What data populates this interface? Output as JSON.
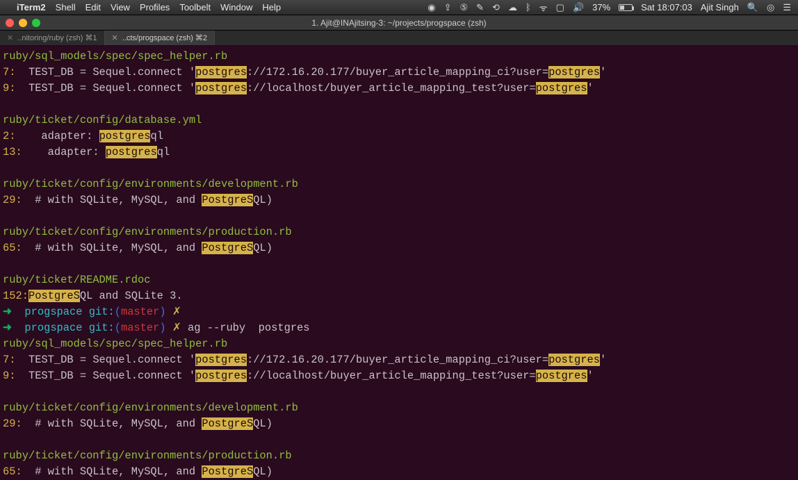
{
  "menubar": {
    "app": "iTerm2",
    "items": [
      "Shell",
      "Edit",
      "View",
      "Profiles",
      "Toolbelt",
      "Window",
      "Help"
    ],
    "battery_pct": "37%",
    "clock": "Sat 18:07:03",
    "user": "Ajit Singh"
  },
  "window": {
    "title": "1. Ajit@INAjitsing-3: ~/projects/progspace (zsh)",
    "tabs": [
      {
        "label": "..nitoring/ruby (zsh)   ⌘1",
        "active": false
      },
      {
        "label": "..cts/progspace (zsh)   ⌘2",
        "active": true
      }
    ]
  },
  "blocks": [
    {
      "file": "ruby/sql_models/spec/spec_helper.rb",
      "lines": [
        {
          "n": "7:",
          "segs": [
            "  TEST_DB = Sequel.connect '",
            [
              "postgres"
            ],
            "://172.16.20.177/buyer_article_mapping_ci?user=",
            [
              "postgres"
            ],
            "'"
          ]
        },
        {
          "n": "9:",
          "segs": [
            "  TEST_DB = Sequel.connect '",
            [
              "postgres"
            ],
            "://localhost/buyer_article_mapping_test?user=",
            [
              "postgres"
            ],
            "'"
          ]
        }
      ]
    },
    {
      "file": "ruby/ticket/config/database.yml",
      "lines": [
        {
          "n": "2:",
          "segs": [
            "    adapter: ",
            [
              "postgres"
            ],
            "ql"
          ]
        },
        {
          "n": "13:",
          "segs": [
            "    adapter: ",
            [
              "postgres"
            ],
            "ql"
          ]
        }
      ]
    },
    {
      "file": "ruby/ticket/config/environments/development.rb",
      "lines": [
        {
          "n": "29:",
          "segs": [
            "  # with SQLite, MySQL, and ",
            [
              "PostgreS"
            ],
            "QL)"
          ]
        }
      ]
    },
    {
      "file": "ruby/ticket/config/environments/production.rb",
      "lines": [
        {
          "n": "65:",
          "segs": [
            "  # with SQLite, MySQL, and ",
            [
              "PostgreS"
            ],
            "QL)"
          ]
        }
      ]
    },
    {
      "file": "ruby/ticket/README.rdoc",
      "lines": [
        {
          "n": "152:",
          "segs": [
            [
              "PostgreS"
            ],
            "QL and SQLite 3."
          ]
        }
      ]
    }
  ],
  "prompts": [
    {
      "dir": "progspace",
      "branch": "master",
      "dirty": "✗",
      "cmd": ""
    },
    {
      "dir": "progspace",
      "branch": "master",
      "dirty": "✗",
      "cmd": "ag --ruby  postgres"
    }
  ],
  "blocks2": [
    {
      "file": "ruby/sql_models/spec/spec_helper.rb",
      "lines": [
        {
          "n": "7:",
          "segs": [
            "  TEST_DB = Sequel.connect '",
            [
              "postgres"
            ],
            "://172.16.20.177/buyer_article_mapping_ci?user=",
            [
              "postgres"
            ],
            "'"
          ]
        },
        {
          "n": "9:",
          "segs": [
            "  TEST_DB = Sequel.connect '",
            [
              "postgres"
            ],
            "://localhost/buyer_article_mapping_test?user=",
            [
              "postgres"
            ],
            "'"
          ]
        }
      ]
    },
    {
      "file": "ruby/ticket/config/environments/development.rb",
      "lines": [
        {
          "n": "29:",
          "segs": [
            "  # with SQLite, MySQL, and ",
            [
              "PostgreS"
            ],
            "QL)"
          ]
        }
      ]
    },
    {
      "file": "ruby/ticket/config/environments/production.rb",
      "lines": [
        {
          "n": "65:",
          "segs": [
            "  # with SQLite, MySQL, and ",
            [
              "PostgreS"
            ],
            "QL)"
          ]
        }
      ]
    }
  ]
}
